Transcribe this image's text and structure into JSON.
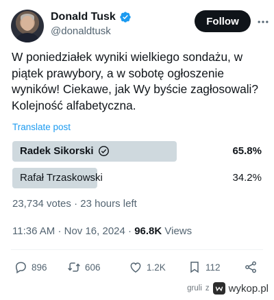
{
  "author": {
    "display_name": "Donald Tusk",
    "handle": "@donaldtusk"
  },
  "header": {
    "follow_label": "Follow"
  },
  "tweet": {
    "text": "W poniedziałek wyniki wielkiego sondażu, w piątek prawybory, a w sobotę ogłoszenie wyników! Ciekawe, jak Wy byście zagłosowali? Kolejność alfabetyczna.",
    "translate_label": "Translate post"
  },
  "poll": {
    "options": [
      {
        "label": "Radek Sikorski",
        "percent": "65.8%",
        "fraction": 0.658,
        "selected": true
      },
      {
        "label": "Rafał Trzaskowski",
        "percent": "34.2%",
        "fraction": 0.342,
        "selected": false
      }
    ],
    "votes": "23,734 votes",
    "separator": "·",
    "time_left": "23 hours left"
  },
  "timestamp": {
    "time": "11:36 AM",
    "date": "Nov 16, 2024",
    "separator": "·",
    "views_count": "96.8K",
    "views_label": "Views"
  },
  "actions": {
    "replies": "896",
    "reposts": "606",
    "likes": "1.2K",
    "bookmarks": "112"
  },
  "watermark": {
    "user": "gruli",
    "via": "z",
    "site": "wykop.pl"
  },
  "colors": {
    "accent": "#1d9bf0",
    "poll_bar": "#cfd9de",
    "muted": "#536471",
    "follow_bg": "#0f1419"
  }
}
